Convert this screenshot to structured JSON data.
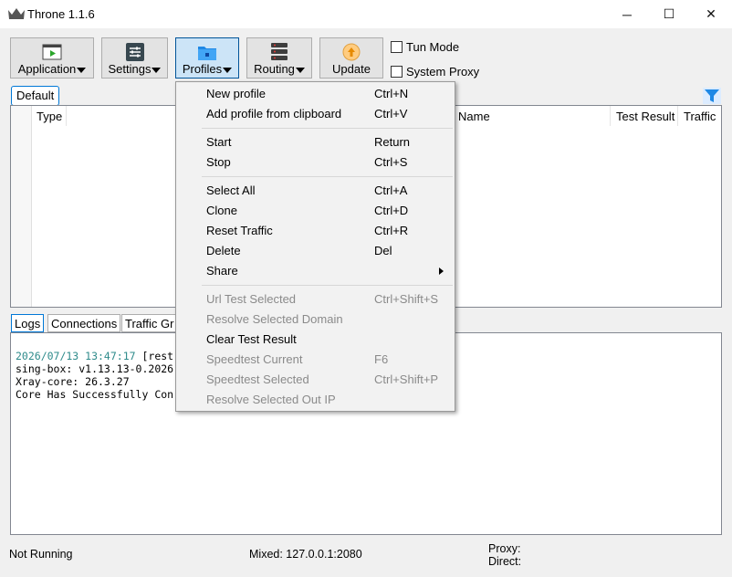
{
  "window": {
    "title": "Throne 1.1.6",
    "controls": {
      "minimize": "─",
      "maximize": "☐",
      "close": "✕"
    }
  },
  "toolbar": {
    "buttons": [
      {
        "label": "Application",
        "icon": "application-icon",
        "has_dropdown": true
      },
      {
        "label": "Settings",
        "icon": "settings-icon",
        "has_dropdown": true
      },
      {
        "label": "Profiles",
        "icon": "profiles-folder-icon",
        "has_dropdown": true,
        "active": true
      },
      {
        "label": "Routing",
        "icon": "routing-icon",
        "has_dropdown": true
      },
      {
        "label": "Update",
        "icon": "update-icon",
        "has_dropdown": false
      }
    ],
    "tun_mode": {
      "label": "Tun Mode",
      "checked": false
    },
    "system_proxy": {
      "label": "System Proxy",
      "checked": false
    }
  },
  "group_tab": "Default",
  "table": {
    "columns": [
      "Type",
      "Name",
      "Test Result",
      "Traffic"
    ]
  },
  "bottom_tabs": [
    "Logs",
    "Connections",
    "Traffic Gr"
  ],
  "log_lines": [
    {
      "timestamp": "2026/07/13 13:47:17",
      "text": " [rest"
    },
    {
      "timestamp": "",
      "text": "sing-box: v1.13.13-0.2026"
    },
    {
      "timestamp": "",
      "text": "Xray-core: 26.3.27"
    },
    {
      "timestamp": "",
      "text": "Core Has Successfully Con"
    }
  ],
  "status": {
    "state": "Not Running",
    "mixed": "Mixed: 127.0.0.1:2080",
    "proxy": "Proxy:",
    "direct": "Direct:"
  },
  "profiles_menu": {
    "items": [
      {
        "label": "New profile",
        "shortcut": "Ctrl+N",
        "enabled": true
      },
      {
        "label": "Add profile from clipboard",
        "shortcut": "Ctrl+V",
        "enabled": true
      },
      {
        "label": "Start",
        "shortcut": "Return",
        "enabled": true
      },
      {
        "label": "Stop",
        "shortcut": "Ctrl+S",
        "enabled": true
      },
      {
        "label": "Select All",
        "shortcut": "Ctrl+A",
        "enabled": true
      },
      {
        "label": "Clone",
        "shortcut": "Ctrl+D",
        "enabled": true
      },
      {
        "label": "Reset Traffic",
        "shortcut": "Ctrl+R",
        "enabled": true
      },
      {
        "label": "Delete",
        "shortcut": "Del",
        "enabled": true
      },
      {
        "label": "Share",
        "shortcut": "",
        "enabled": true,
        "submenu": true
      },
      {
        "label": "Url Test Selected",
        "shortcut": "Ctrl+Shift+S",
        "enabled": false
      },
      {
        "label": "Resolve Selected Domain",
        "shortcut": "",
        "enabled": false
      },
      {
        "label": "Clear Test Result",
        "shortcut": "",
        "enabled": true
      },
      {
        "label": "Speedtest Current",
        "shortcut": "F6",
        "enabled": false
      },
      {
        "label": "Speedtest Selected",
        "shortcut": "Ctrl+Shift+P",
        "enabled": false
      },
      {
        "label": "Resolve Selected Out IP",
        "shortcut": "",
        "enabled": false
      }
    ]
  },
  "colors": {
    "accent": "#0078d7",
    "timestamp": "#2e8b8b",
    "disabled_text": "#8a8a8a",
    "filter_icon": "#1e88e5"
  }
}
